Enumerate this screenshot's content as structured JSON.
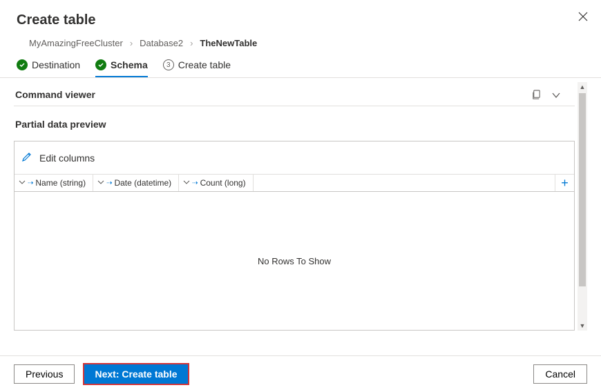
{
  "header": {
    "title": "Create table"
  },
  "breadcrumb": {
    "items": [
      "MyAmazingFreeCluster",
      "Database2",
      "TheNewTable"
    ]
  },
  "steps": [
    {
      "label": "Destination",
      "state": "done"
    },
    {
      "label": "Schema",
      "state": "active"
    },
    {
      "label": "Create table",
      "state": "pending",
      "num": "3"
    }
  ],
  "sections": {
    "command_viewer": "Command viewer",
    "partial_preview": "Partial data preview",
    "edit_columns": "Edit columns",
    "no_rows": "No Rows To Show"
  },
  "columns": [
    {
      "name": "Name (string)"
    },
    {
      "name": "Date (datetime)"
    },
    {
      "name": "Count (long)"
    }
  ],
  "footer": {
    "previous": "Previous",
    "next": "Next: Create table",
    "cancel": "Cancel"
  }
}
